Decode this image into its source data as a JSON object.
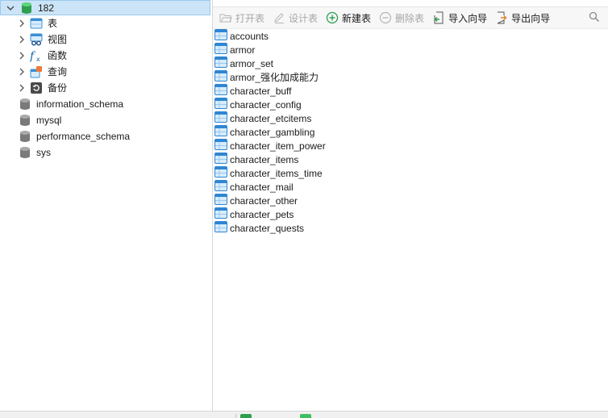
{
  "tree": {
    "connection": {
      "label": "182",
      "expanded": true
    },
    "categories": [
      {
        "label": "表",
        "icon": "table-icon"
      },
      {
        "label": "视图",
        "icon": "view-icon"
      },
      {
        "label": "函数",
        "icon": "function-icon"
      },
      {
        "label": "查询",
        "icon": "query-icon"
      },
      {
        "label": "备份",
        "icon": "backup-icon"
      }
    ],
    "databases": [
      {
        "label": "information_schema"
      },
      {
        "label": "mysql"
      },
      {
        "label": "performance_schema"
      },
      {
        "label": "sys"
      }
    ]
  },
  "toolbar": {
    "open_table": "打开表",
    "design_table": "设计表",
    "new_table": "新建表",
    "delete_table": "删除表",
    "import_wizard": "导入向导",
    "export_wizard": "导出向导"
  },
  "tables": [
    "accounts",
    "armor",
    "armor_set",
    "armor_强化加成能力",
    "character_buff",
    "character_config",
    "character_etcitems",
    "character_gambling",
    "character_item_power",
    "character_items",
    "character_items_time",
    "character_mail",
    "character_other",
    "character_pets",
    "character_quests"
  ],
  "colors": {
    "accent": "#1a73c8",
    "selection": "#cce4f7",
    "db_green": "#2e9e4f",
    "db_gray": "#808080"
  }
}
